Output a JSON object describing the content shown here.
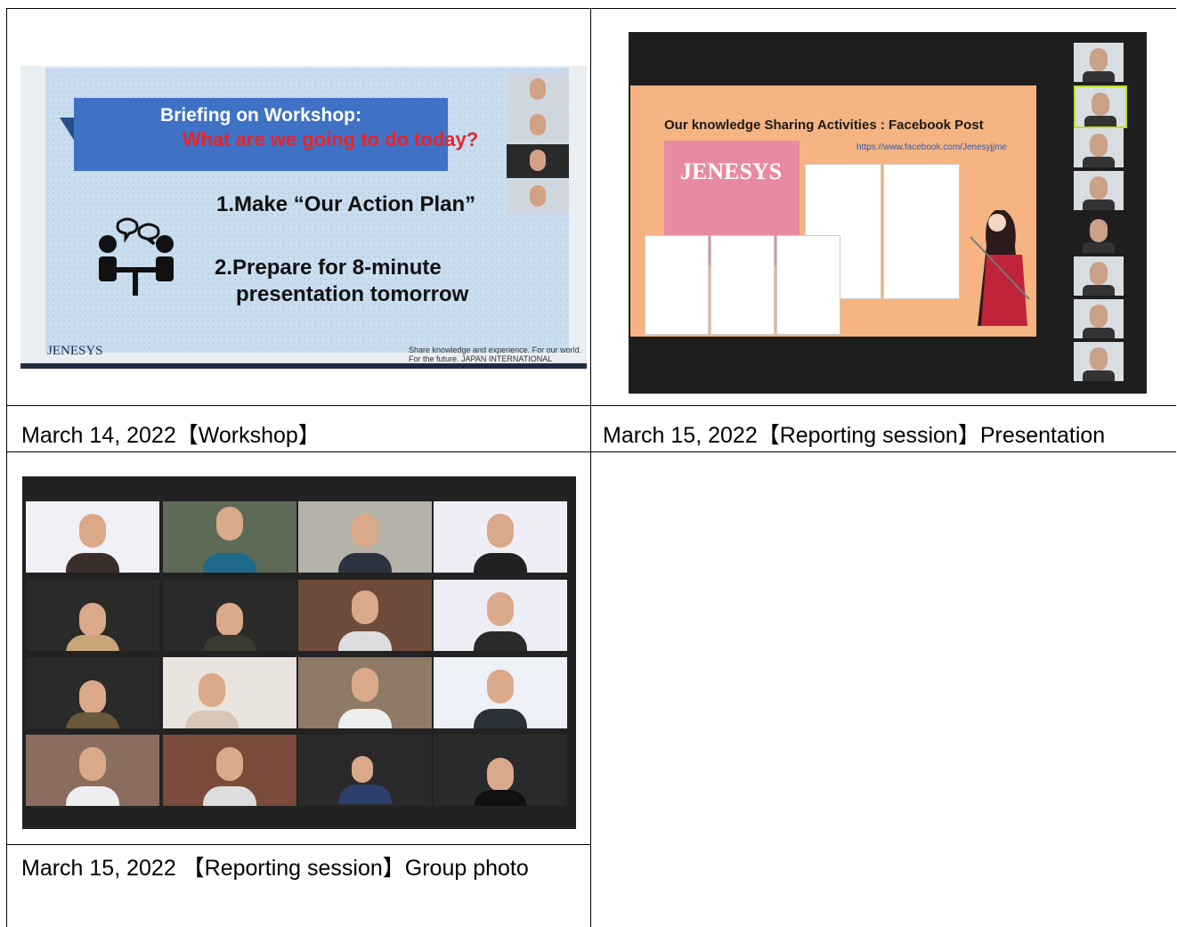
{
  "cells": {
    "workshop": {
      "caption": "March 14, 2022【Workshop】",
      "slide": {
        "title_line1": "Briefing on Workshop:",
        "title_line2": "What are we going to do today?",
        "bullet1": "1.Make “Our Action Plan”",
        "bullet2_line1": "2.Prepare for 8-minute",
        "bullet2_line2": "presentation tomorrow",
        "logo_text": "JENESYS",
        "org_text": "Share knowledge and experience. For our world. For the future. JAPAN INTERNATIONAL COOPERATION CENTER"
      }
    },
    "presentation": {
      "caption": "March 15, 2022【Reporting session】Presentation",
      "slide": {
        "title": "Our knowledge Sharing Activities : Facebook Post",
        "link": "https://www.facebook.com/Jenesyjjme",
        "banner_text": "JENESYS"
      }
    },
    "group_photo": {
      "caption": "March 15, 2022 【Reporting session】Group photo"
    }
  },
  "colors": {
    "banner_blue": "#3f72c4",
    "title_red": "#e8242a",
    "slide_orange": "#f5b482",
    "dark_bg": "#222222"
  }
}
